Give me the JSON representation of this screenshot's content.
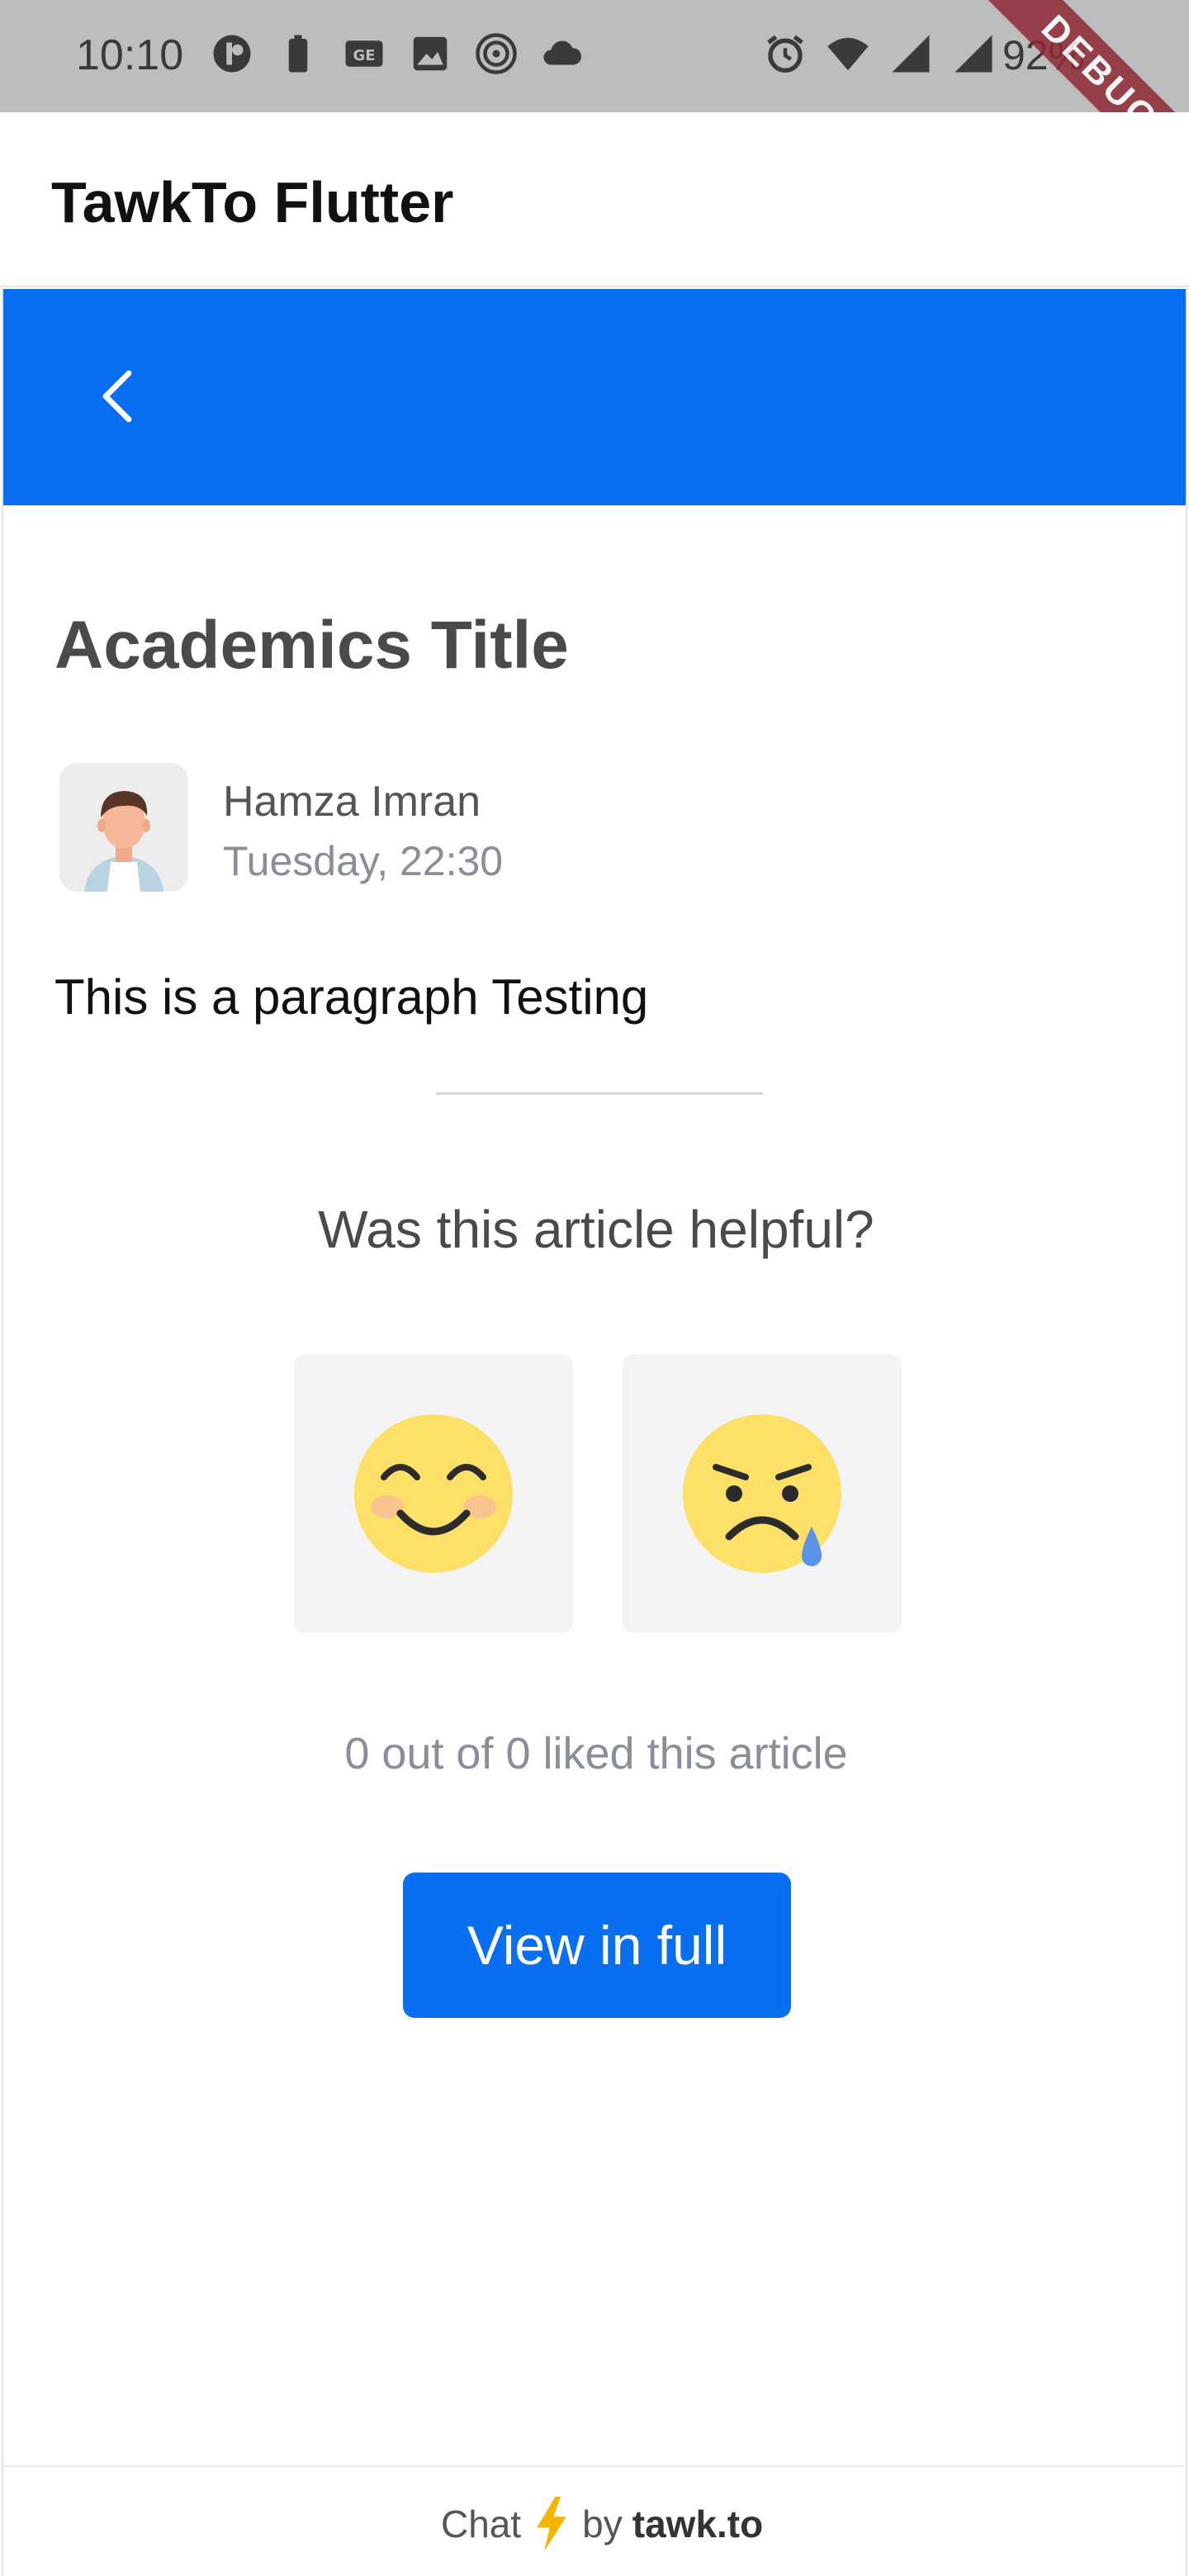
{
  "status_bar": {
    "time": "10:10",
    "battery": "92%",
    "icons_left": [
      "notification-app-icon",
      "battery-saver-icon",
      "ge-icon",
      "image-icon",
      "hotspot-icon",
      "cloud-icon"
    ],
    "icons_right": [
      "alarm-icon",
      "wifi-icon",
      "signal-icon",
      "signal-icon-2"
    ]
  },
  "debug_ribbon": "DEBUG",
  "app_bar": {
    "title": "TawkTo Flutter"
  },
  "kb_header": {
    "color": "#0a6ef0",
    "back_icon": "chevron-left-icon"
  },
  "article": {
    "title": "Academics Title",
    "author_name": "Hamza Imran",
    "author_date": "Tuesday, 22:30",
    "paragraph": "This is a paragraph Testing"
  },
  "feedback": {
    "question": "Was this article helpful?",
    "reactions": [
      "smiling-face-icon",
      "sad-tear-face-icon"
    ],
    "liked_text": "0 out of 0 liked this article"
  },
  "actions": {
    "view_full": "View in full"
  },
  "footer": {
    "prefix": "Chat",
    "by": "by",
    "brand": "tawk.to"
  }
}
